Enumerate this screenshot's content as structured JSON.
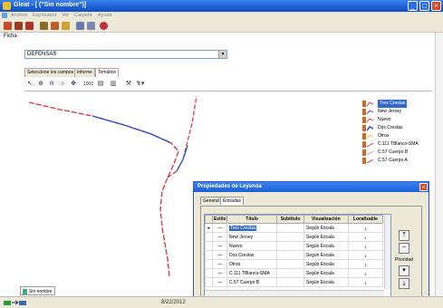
{
  "window": {
    "title": "Gleat - [ (\"Sin nombre\")]"
  },
  "menubar": {
    "items": [
      "Archivo",
      "Explorador",
      "Ver",
      "Carpeta",
      "Ayuda"
    ]
  },
  "ficha": {
    "label": "Ficha",
    "value": "DEFENSAS"
  },
  "tabs": [
    "Seleccione los campos",
    "Informe",
    "Temático"
  ],
  "active_tab": "Temático",
  "legend": {
    "items": [
      {
        "label": "Tres Crestas",
        "selected": true
      },
      {
        "label": "New Jersey"
      },
      {
        "label": "Nuevo"
      },
      {
        "label": "Dos Crestas"
      },
      {
        "label": "Otros"
      },
      {
        "label": "C.111 TBlanco-SMA"
      },
      {
        "label": "C.57 Cuerpo B"
      },
      {
        "label": "C.57 Cuerpo A"
      }
    ]
  },
  "dialog": {
    "title": "Propiedades de Leyenda",
    "tabs": [
      "General",
      "Entradas"
    ],
    "columns": [
      "Estilo",
      "Título",
      "Subtítulo",
      "Visualización",
      "Localizable"
    ],
    "rows": [
      {
        "titulo": "Tres Crestas",
        "subtitulo": "",
        "visualizacion": "Según Escala"
      },
      {
        "titulo": "New Jersey",
        "subtitulo": "",
        "visualizacion": "Según Escala"
      },
      {
        "titulo": "Nuevo",
        "subtitulo": "",
        "visualizacion": "Según Escala"
      },
      {
        "titulo": "Dos Crestas",
        "subtitulo": "",
        "visualizacion": "Según Escala"
      },
      {
        "titulo": "Otros",
        "subtitulo": "",
        "visualizacion": "Según Escala"
      },
      {
        "titulo": "C.111 TBlanco-SMA",
        "subtitulo": "",
        "visualizacion": "Según Escala"
      },
      {
        "titulo": "C.57 Cuerpo B",
        "subtitulo": "",
        "visualizacion": "Según Escala"
      }
    ],
    "prioridad_label": "Prioridad"
  },
  "document_tab": "Sin nombre",
  "status": {
    "date": "8/22/2012"
  },
  "colors": {
    "titlebar": "#1a5fd6",
    "selection": "#316ac5",
    "road_red": "#d04050",
    "road_blue": "#3050c0"
  }
}
